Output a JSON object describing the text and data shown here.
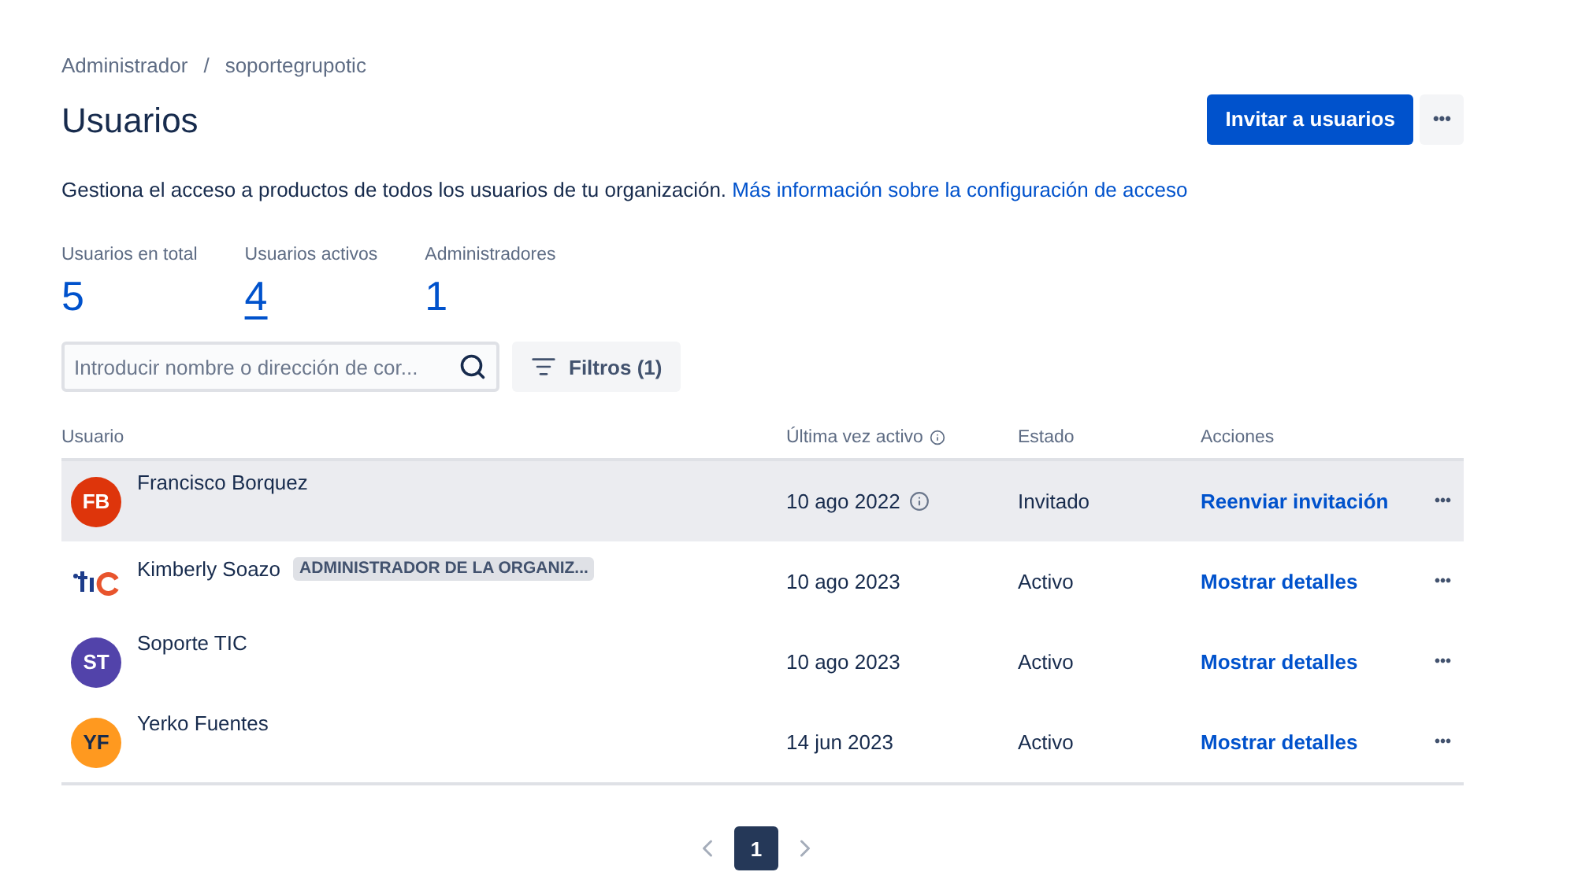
{
  "breadcrumbs": {
    "separator": "/",
    "items": [
      {
        "label": "Administrador"
      },
      {
        "label": "soportegrupotic"
      }
    ]
  },
  "title": "Usuarios",
  "header_actions": {
    "primary": "Invitar a usuarios",
    "more": "•••"
  },
  "description": {
    "text": "Gestiona el acceso a productos de todos los usuarios de tu organización.",
    "link": "Más información sobre la configuración de acceso"
  },
  "stats": [
    {
      "label": "Usuarios en total",
      "value": "5",
      "underlined": false
    },
    {
      "label": "Usuarios activos",
      "value": "4",
      "underlined": true
    },
    {
      "label": "Administradores",
      "value": "1",
      "underlined": false
    }
  ],
  "search": {
    "placeholder": "Introducir nombre o dirección de cor..."
  },
  "filter_button": "Filtros (1)",
  "table": {
    "columns": [
      {
        "label": "Usuario",
        "info": false
      },
      {
        "label": "Última vez activo",
        "info": true
      },
      {
        "label": "Estado",
        "info": false
      },
      {
        "label": "Acciones",
        "info": false
      }
    ],
    "rows": [
      {
        "avatar": {
          "kind": "initials",
          "initials": "FB",
          "color": "#de350b"
        },
        "name": "Francisco Borquez",
        "badge": null,
        "last_active": "10 ago 2022",
        "info": true,
        "status": "Invitado",
        "action": "Reenviar invitación",
        "more": "•••",
        "highlighted": true
      },
      {
        "avatar": {
          "kind": "logo"
        },
        "name": "Kimberly Soazo",
        "badge": "ADMINISTRADOR DE LA ORGANIZ...",
        "last_active": "10 ago 2023",
        "info": false,
        "status": "Activo",
        "action": "Mostrar detalles",
        "more": "•••",
        "highlighted": false
      },
      {
        "avatar": {
          "kind": "initials",
          "initials": "ST",
          "color": "#5243aa"
        },
        "name": "Soporte TIC",
        "badge": null,
        "last_active": "10 ago 2023",
        "info": false,
        "status": "Activo",
        "action": "Mostrar detalles",
        "more": "•••",
        "highlighted": false
      },
      {
        "avatar": {
          "kind": "initials",
          "initials": "YF",
          "color": "#ff991f"
        },
        "name": "Yerko Fuentes",
        "badge": null,
        "last_active": "14 jun 2023",
        "info": false,
        "status": "Activo",
        "action": "Mostrar detalles",
        "more": "•••",
        "highlighted": false
      }
    ]
  },
  "pagination": {
    "pages": [
      {
        "label": "1",
        "selected": true
      }
    ]
  }
}
